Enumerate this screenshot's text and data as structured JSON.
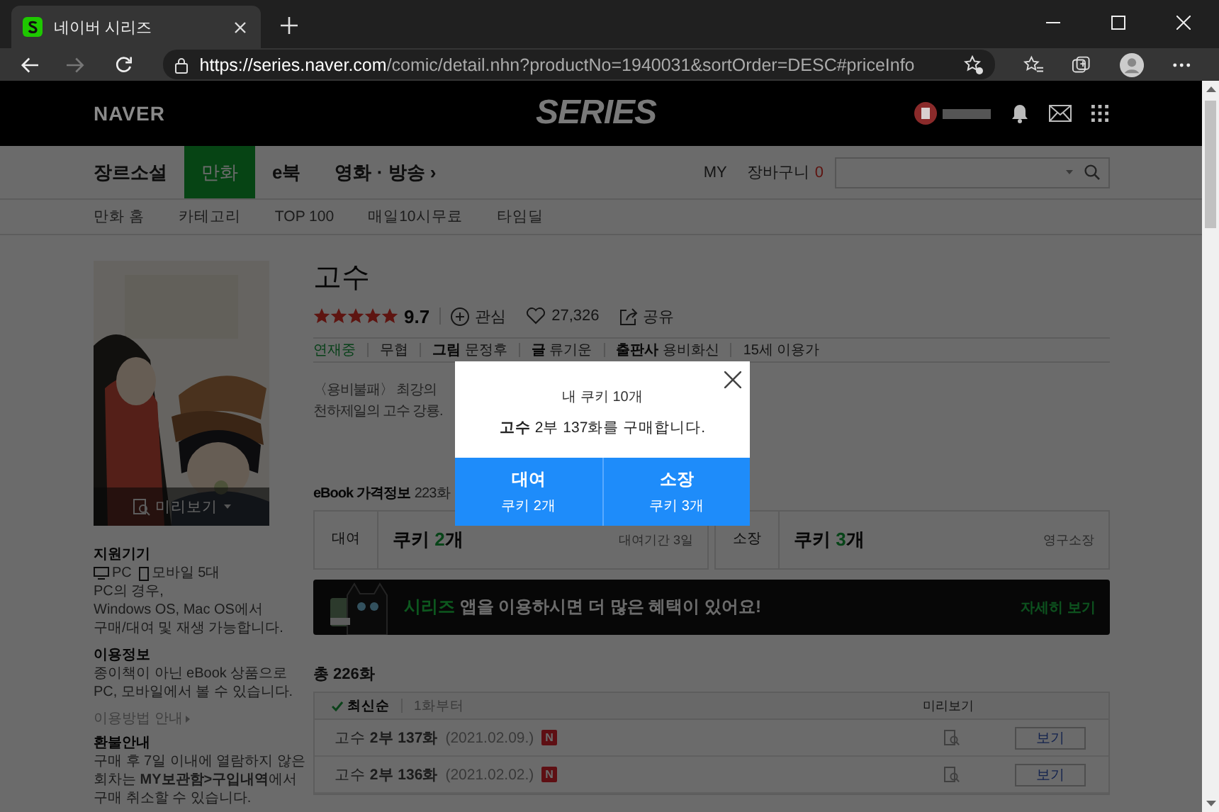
{
  "browser": {
    "tab": {
      "title": "네이버 시리즈"
    },
    "url": {
      "host": "https://series.naver.com",
      "path": "/comic/detail.nhn?productNo=1940031&sortOrder=DESC#priceInfo"
    }
  },
  "header": {
    "logo": "NAVER",
    "brand": "SERIES"
  },
  "nav": {
    "items": [
      {
        "label": "장르소설",
        "selected": false
      },
      {
        "label": "만화",
        "selected": true
      },
      {
        "label": "e북",
        "selected": false
      },
      {
        "label": "영화 · 방송 ›",
        "selected": false
      }
    ],
    "my": "MY",
    "cart": {
      "label": "장바구니",
      "count": "0"
    }
  },
  "subnav": [
    "만화 홈",
    "카테고리",
    "TOP 100",
    "매일10시무료",
    "타임딜"
  ],
  "cover": {
    "preview": "미리보기"
  },
  "sidebar": {
    "devices": {
      "title": "지원기기",
      "pc": "PC",
      "mobile": "모바일 5대",
      "note": [
        "PC의 경우,",
        "Windows OS, Mac OS에서",
        "구매/대여 및 재생 가능합니다."
      ]
    },
    "usage": {
      "title": "이용정보",
      "text": [
        "종이책이 아닌 eBook 상품으로",
        "PC, 모바일에서 볼 수 있습니다."
      ],
      "link": "이용방법 안내"
    },
    "refund": {
      "title": "환불안내",
      "text": [
        "구매 후 7일 이내에 열람하지 않은",
        "회차는 **MY보관함>구입내역**에서",
        "구매 취소할 수 있습니다."
      ]
    }
  },
  "title": "고수",
  "rating": {
    "stars": 5,
    "score": "9.7",
    "interest": "관심",
    "likes": "27,326",
    "share": "공유"
  },
  "meta": [
    {
      "kind": "status",
      "value": "연재중"
    },
    {
      "kind": "plain",
      "value": "무협"
    },
    {
      "kind": "credit",
      "label": "그림",
      "value": "문정후"
    },
    {
      "kind": "credit",
      "label": "글",
      "value": "류기운"
    },
    {
      "kind": "credit",
      "label": "출판사",
      "value": "용비화신"
    },
    {
      "kind": "plain",
      "value": "15세 이용가"
    }
  ],
  "description": [
    "〈용비불패〉 최강의",
    "천하제일의 고수 강룡."
  ],
  "price_info": {
    "title": "eBook 가격정보",
    "note": "223화"
  },
  "prices": [
    {
      "type": "대여",
      "prefix": "쿠키 ",
      "count": "2",
      "unit": "개",
      "period": "대여기간 3일"
    },
    {
      "type": "소장",
      "prefix": "쿠키 ",
      "count": "3",
      "unit": "개",
      "period": "영구소장"
    }
  ],
  "banner": {
    "brand": "시리즈",
    "text": " 앱을 이용하시면 더 많은 혜택이 있어요!",
    "link": "자세히 보기"
  },
  "episodes": {
    "total": "총 226화",
    "sort": [
      {
        "label": "최신순",
        "selected": true
      },
      {
        "label": "1화부터",
        "selected": false
      }
    ],
    "preview_header": "미리보기",
    "rows": [
      {
        "title": "고수 **2부 137화**",
        "date": "(2021.02.09.)",
        "badge": "N",
        "button": "보기"
      },
      {
        "title": "고수 **2부 136화**",
        "date": "(2021.02.02.)",
        "badge": "N",
        "button": "보기"
      }
    ]
  },
  "modal": {
    "cookies": "내 쿠키 10개",
    "message": "**고수** 2부 137화를 구매합니다.",
    "buttons": [
      {
        "label": "대여",
        "sub": "쿠키 2개"
      },
      {
        "label": "소장",
        "sub": "쿠키 3개"
      }
    ]
  }
}
